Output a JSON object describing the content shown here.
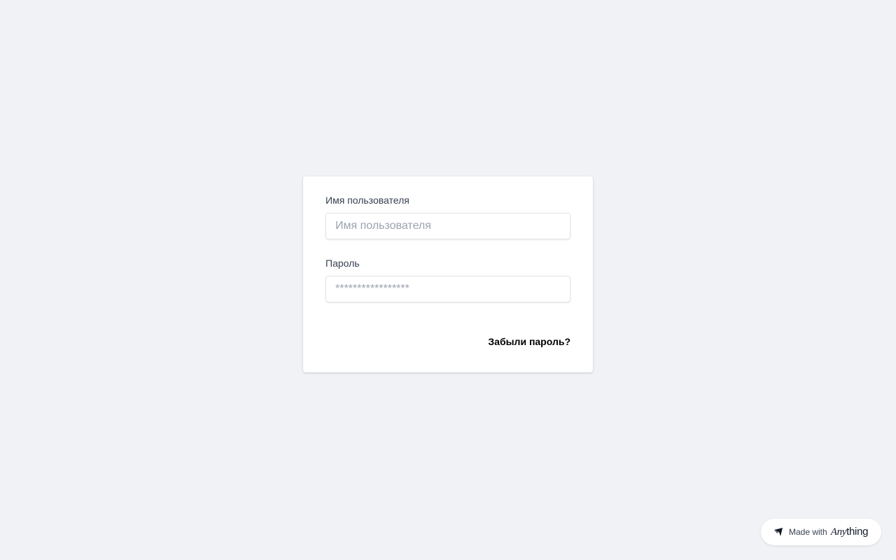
{
  "login_form": {
    "username": {
      "label": "Имя пользователя",
      "placeholder": "Имя пользователя",
      "value": ""
    },
    "password": {
      "label": "Пароль",
      "placeholder": "*****************",
      "value": ""
    },
    "forgot_password_label": "Забыли пароль?"
  },
  "badge": {
    "made_with": "Made with",
    "brand_any": "Any",
    "brand_thing": "thing",
    "icon": "anything-logo-icon"
  },
  "colors": {
    "background": "#f0f2f5",
    "card": "#ffffff",
    "label_text": "#374151",
    "placeholder_text": "#9ca3af",
    "link_text": "#000000"
  }
}
